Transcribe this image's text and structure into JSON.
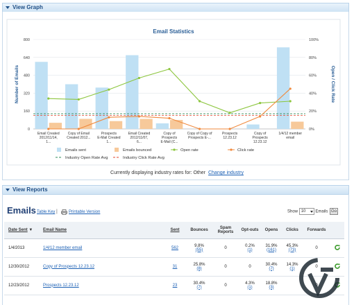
{
  "graph_section": {
    "title": "View Graph"
  },
  "reports_section": {
    "title": "View Reports"
  },
  "chart_data": {
    "type": "bar",
    "title": "Email Statistics",
    "ylabel": "Number of Emails",
    "y2label": "Open / Click Rate",
    "ylim": [
      0,
      800
    ],
    "y2lim": [
      0,
      100
    ],
    "yticks": [
      "0",
      "160",
      "320",
      "480",
      "640",
      "800"
    ],
    "y2ticks": [
      "0%",
      "20%",
      "40%",
      "60%",
      "80%",
      "100%"
    ],
    "categories": [
      "Email Created 2012/11/14, 1...",
      "Copy of Email Created 2012...",
      "Prospects E-Mail Created 1...",
      "Email Created 2012/11/07, 6...",
      "Copy of Prospects E-Mail (C...",
      "Copy of Copy of Prospects E-...",
      "Prospects 12.23.12",
      "Copy of Prospects 12.23.12",
      "1/4/12 member email"
    ],
    "series": [
      {
        "name": "Emails sent",
        "kind": "bar",
        "color": "#bfe0f4",
        "values": [
          600,
          400,
          370,
          660,
          50,
          0,
          0,
          40,
          730
        ]
      },
      {
        "name": "Emails bounced",
        "kind": "bar",
        "color": "#f7c99a",
        "values": [
          55,
          90,
          70,
          90,
          80,
          0,
          0,
          0,
          65
        ]
      },
      {
        "name": "Open rate",
        "kind": "line",
        "color": "#8dc63f",
        "values": [
          34,
          33,
          44,
          57,
          67,
          31,
          18,
          29,
          31
        ]
      },
      {
        "name": "Click rate",
        "kind": "line",
        "color": "#f08a3e",
        "values": [
          0,
          0,
          13,
          14,
          12,
          0,
          0,
          14,
          45
        ]
      },
      {
        "name": "Industry Open Rate Avg",
        "kind": "hline",
        "color": "#2e8b57",
        "values": [
          17
        ]
      },
      {
        "name": "Industry Click Rate Avg",
        "kind": "hline",
        "color": "#e2442b",
        "values": [
          15
        ]
      }
    ],
    "legend": [
      {
        "label": "Emails sent",
        "color": "#bfe0f4",
        "shape": "bar"
      },
      {
        "label": "Emails bounced",
        "color": "#f7c99a",
        "shape": "bar"
      },
      {
        "label": "Open rate",
        "color": "#8dc63f",
        "shape": "line"
      },
      {
        "label": "Click rate",
        "color": "#f08a3e",
        "shape": "line"
      },
      {
        "label": "Industry Open Rate Avg",
        "color": "#2e8b57",
        "shape": "dash"
      },
      {
        "label": "Industry Click Rate Avg",
        "color": "#e2442b",
        "shape": "dash"
      }
    ]
  },
  "industry_note": {
    "text": "Currently displaying industry rates for: Other",
    "link": "Change industry"
  },
  "emails_header": {
    "title": "Emails",
    "table_key_link": "Table Key",
    "separator": "|",
    "printable_link": "Printable Version",
    "show_label": "Show",
    "show_value": "10",
    "show_suffix": "Emails",
    "go_label": "Go"
  },
  "table": {
    "columns": [
      "Date Sent",
      "Email Name",
      "Sent",
      "Bounces",
      "Spam Reports",
      "Opt-outs",
      "Opens",
      "Clicks",
      "Forwards"
    ],
    "sort_indicator": "▼",
    "rows": [
      {
        "date": "1/4/2013",
        "name": "1/4/12 member email",
        "sent": "562",
        "bounces_pct": "9.8%",
        "bounces_n": "(55)",
        "spam": "0",
        "optouts_pct": "0.2%",
        "optouts_n": "(1)",
        "opens_pct": "31.9%",
        "opens_n": "(161)",
        "clicks_pct": "45.3%",
        "clicks_n": "(73)",
        "forwards": "0"
      },
      {
        "date": "12/30/2012",
        "name": "Copy of Prospects 12.23.12",
        "sent": "31",
        "bounces_pct": "25.8%",
        "bounces_n": "(8)",
        "spam": "0",
        "optouts_pct": "0",
        "optouts_n": "",
        "opens_pct": "30.4%",
        "opens_n": "(7)",
        "clicks_pct": "14.3%",
        "clicks_n": "(1)",
        "forwards": "0"
      },
      {
        "date": "12/23/2012",
        "name": "Prospects 12.23.12",
        "sent": "23",
        "bounces_pct": "30.4%",
        "bounces_n": "(7)",
        "spam": "0",
        "optouts_pct": "4.3%",
        "optouts_n": "(1)",
        "opens_pct": "18.8%",
        "opens_n": "(3)",
        "clicks_pct": "",
        "clicks_n": "",
        "forwards": "0"
      }
    ]
  }
}
